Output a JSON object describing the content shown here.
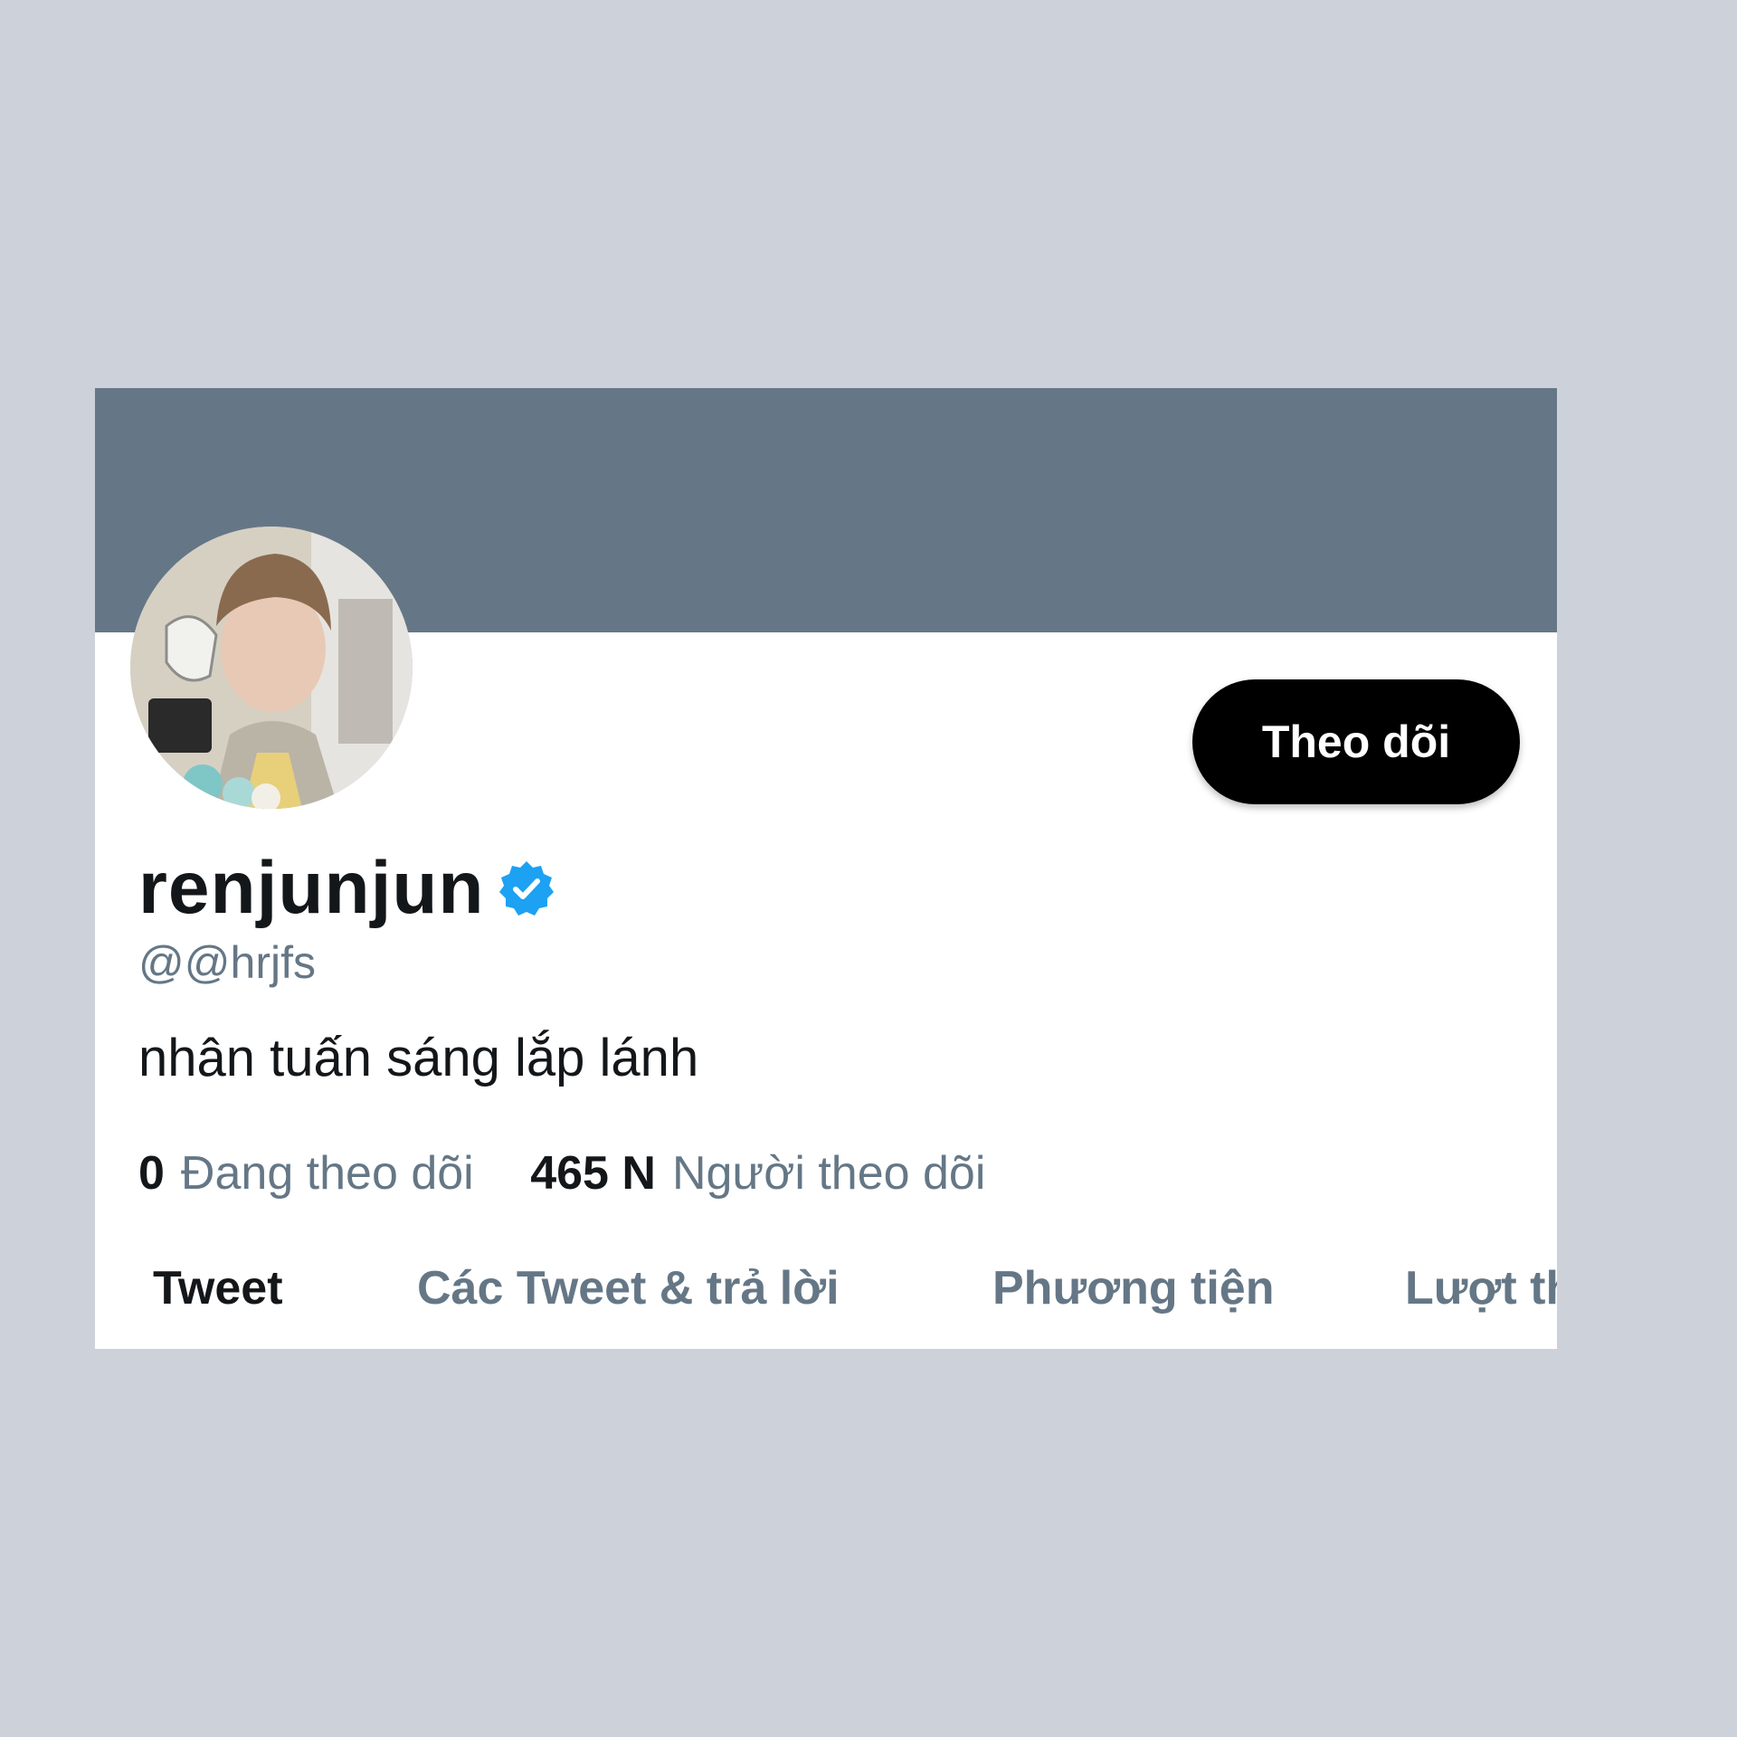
{
  "profile": {
    "display_name": "renjunjun",
    "handle": "@@hrjfs",
    "bio": "nhân tuấn sáng lắp lánh",
    "follow_button": "Theo dõi",
    "verified_icon": "verified-badge-icon",
    "following_count": "0",
    "following_label": "Đang theo dõi",
    "followers_count": "465 N",
    "followers_label": "Người theo dõi"
  },
  "tabs": [
    {
      "label": "Tweet",
      "active": true
    },
    {
      "label": "Các Tweet & trả lời",
      "active": false
    },
    {
      "label": "Phương tiện",
      "active": false
    },
    {
      "label": "Lượt thích",
      "active": false
    }
  ],
  "colors": {
    "background": "#cdd1da",
    "banner": "#657786",
    "verified": "#1da1f2",
    "button": "#000000"
  }
}
